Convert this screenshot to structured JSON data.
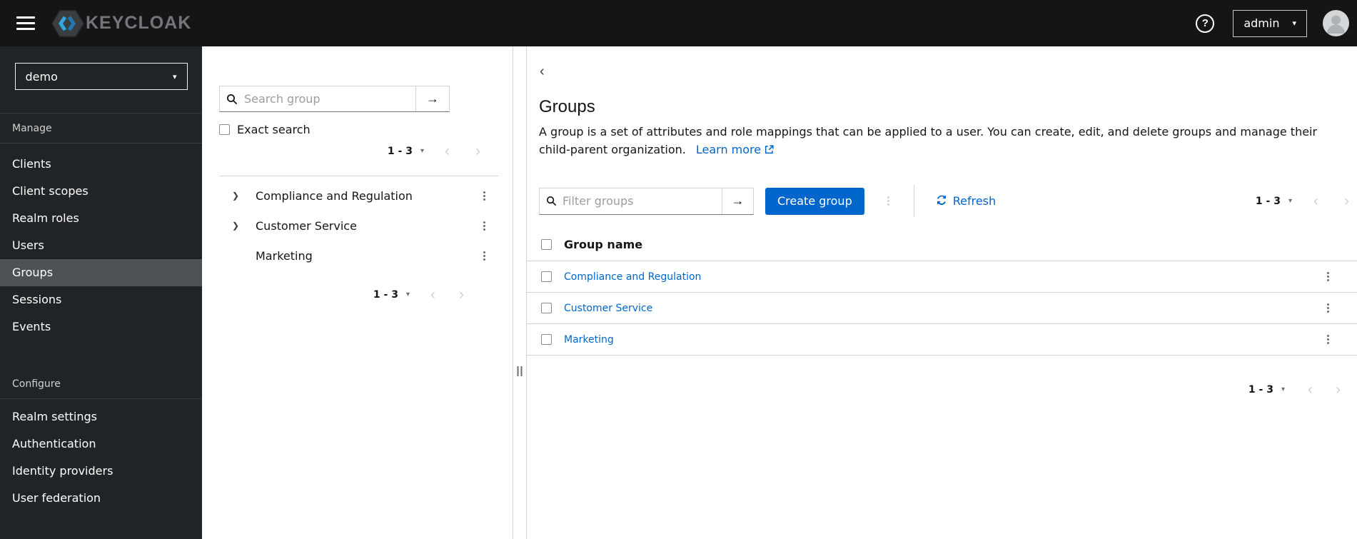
{
  "colors": {
    "accent": "#0066cc",
    "masthead_bg": "#151515",
    "sidebar_bg": "#212427",
    "sidebar_selected_bg": "#4f5255",
    "link_blue": "#0066cc",
    "border_gray": "#d2d2d2"
  },
  "icons": {
    "help": "?",
    "caret_down": "▾",
    "chevron_expand": "❯",
    "pager_prev": "‹",
    "pager_next": "›",
    "arrow_submit": "→",
    "back": "‹"
  },
  "header": {
    "brand": "KEYCLOAK",
    "username": "admin"
  },
  "sidebar": {
    "realm": "demo",
    "sections": [
      {
        "label": "Manage",
        "items": [
          {
            "label": "Clients",
            "selected": false
          },
          {
            "label": "Client scopes",
            "selected": false
          },
          {
            "label": "Realm roles",
            "selected": false
          },
          {
            "label": "Users",
            "selected": false
          },
          {
            "label": "Groups",
            "selected": true
          },
          {
            "label": "Sessions",
            "selected": false
          },
          {
            "label": "Events",
            "selected": false
          }
        ]
      },
      {
        "label": "Configure",
        "items": [
          {
            "label": "Realm settings",
            "selected": false
          },
          {
            "label": "Authentication",
            "selected": false
          },
          {
            "label": "Identity providers",
            "selected": false
          },
          {
            "label": "User federation",
            "selected": false
          }
        ]
      }
    ]
  },
  "tree_panel": {
    "search_placeholder": "Search group",
    "exact_search_label": "Exact search",
    "pagination_top": "1 - 3",
    "pagination_bottom": "1 - 3",
    "items": [
      {
        "label": "Compliance and Regulation",
        "expandable": true
      },
      {
        "label": "Customer Service",
        "expandable": true
      },
      {
        "label": "Marketing",
        "expandable": false
      }
    ]
  },
  "main": {
    "title": "Groups",
    "description": "A group is a set of attributes and role mappings that can be applied to a user. You can create, edit, and delete groups and manage their child-parent organization.",
    "learn_more_label": "Learn more",
    "toolbar": {
      "filter_placeholder": "Filter groups",
      "create_button_label": "Create group",
      "refresh_label": "Refresh",
      "pagination": "1 - 3"
    },
    "table": {
      "header": "Group name",
      "rows": [
        {
          "name": "Compliance and Regulation"
        },
        {
          "name": "Customer Service"
        },
        {
          "name": "Marketing"
        }
      ]
    },
    "pagination_bottom": "1 - 3"
  }
}
